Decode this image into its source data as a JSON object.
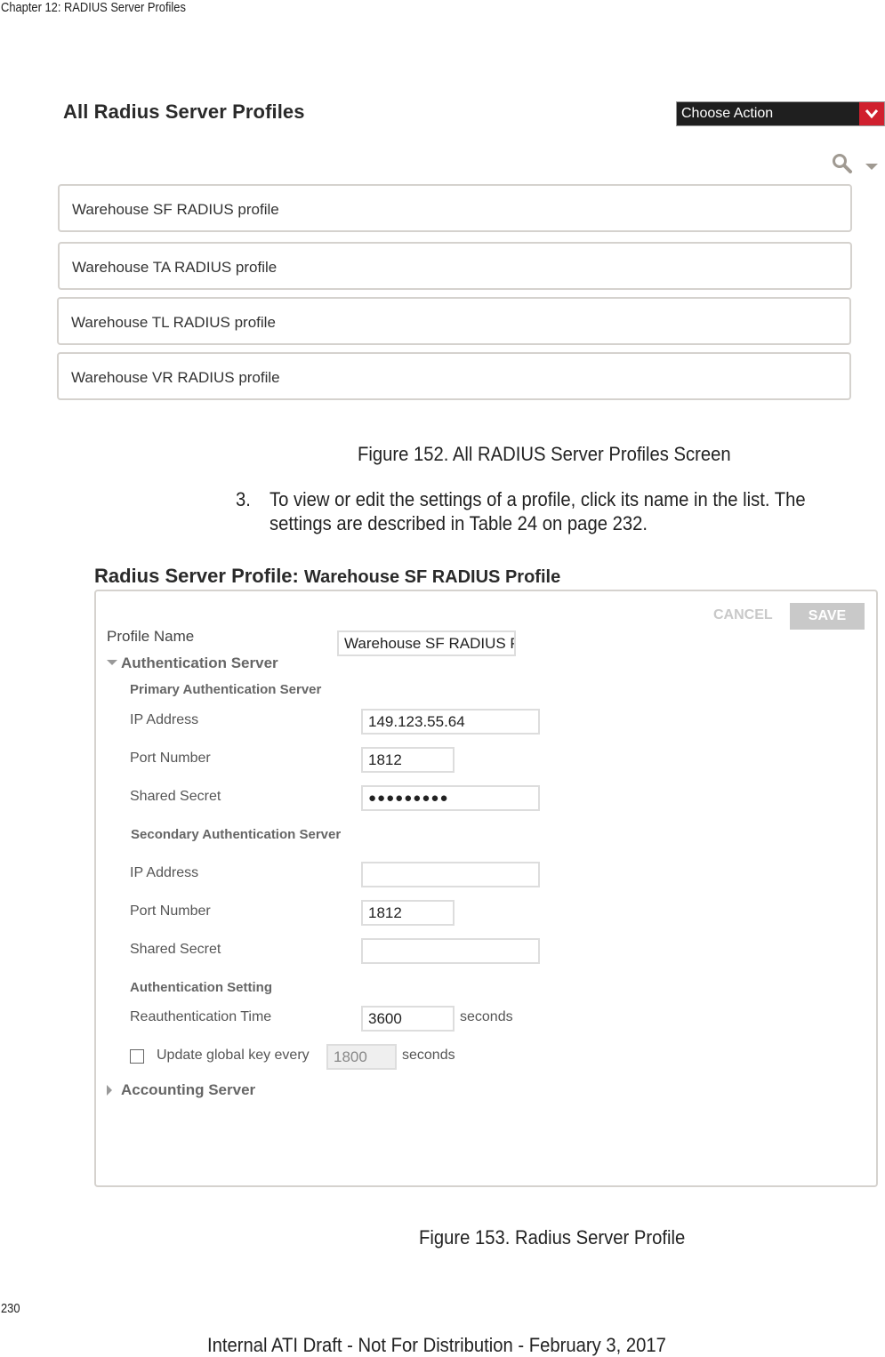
{
  "document": {
    "chapter_header": "Chapter 12: RADIUS Server Profiles",
    "page_number": "230",
    "footer": "Internal ATI Draft - Not For Distribution - February 3, 2017"
  },
  "figure152": {
    "title": "All Radius Server Profiles",
    "choose_action_label": "Choose Action",
    "profiles": [
      "Warehouse SF RADIUS profile",
      "Warehouse TA RADIUS profile",
      "Warehouse TL RADIUS profile",
      "Warehouse VR RADIUS profile"
    ],
    "caption": "Figure 152. All RADIUS Server Profiles Screen"
  },
  "step3": {
    "number": "3.",
    "line1": "To view or edit the settings of a profile, click its name in the list. The",
    "line2": "settings are described in Table 24 on page 232."
  },
  "figure153": {
    "title_prefix": "Radius Server Profile:",
    "title_name": "Warehouse SF RADIUS Profile",
    "cancel_label": "CANCEL",
    "save_label": "SAVE",
    "profile_name_label": "Profile Name",
    "profile_name_value": "Warehouse SF RADIUS P",
    "auth_server_section": "Authentication Server",
    "primary": {
      "heading": "Primary Authentication Server",
      "ip_label": "IP Address",
      "ip_value": "149.123.55.64",
      "port_label": "Port Number",
      "port_value": "1812",
      "secret_label": "Shared Secret",
      "secret_value": "●●●●●●●●●"
    },
    "secondary": {
      "heading": "Secondary Authentication Server",
      "ip_label": "IP Address",
      "ip_value": "",
      "port_label": "Port Number",
      "port_value": "1812",
      "secret_label": "Shared Secret",
      "secret_value": ""
    },
    "auth_setting": {
      "heading": "Authentication Setting",
      "reauth_label": "Reauthentication Time",
      "reauth_value": "3600",
      "reauth_unit": "seconds",
      "update_key_label": "Update global key every",
      "update_key_checked": false,
      "update_key_value": "1800",
      "update_key_unit": "seconds"
    },
    "accounting_section": "Accounting Server",
    "caption": "Figure 153. Radius Server Profile"
  }
}
